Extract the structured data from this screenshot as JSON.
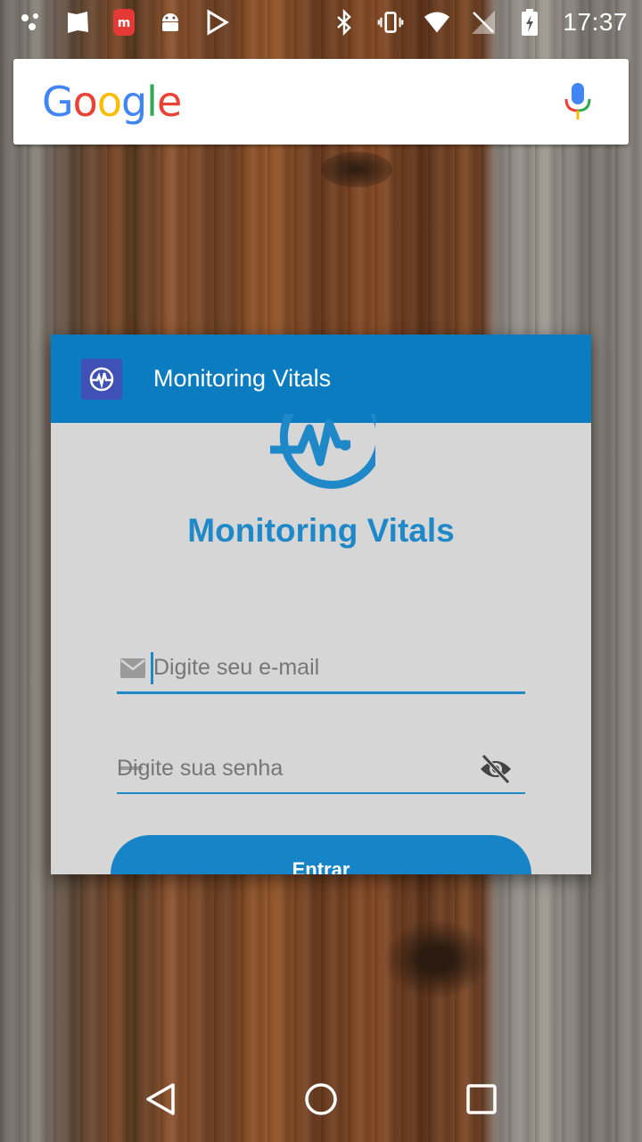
{
  "status_bar": {
    "time": "17:37",
    "left_icons": [
      "notification-dots-icon",
      "map-icon",
      "app-m-icon",
      "android-icon",
      "play-store-icon"
    ],
    "right_icons": [
      "bluetooth-icon",
      "vibrate-icon",
      "wifi-icon",
      "no-sim-icon",
      "battery-charging-icon"
    ]
  },
  "google_search": {
    "logo": [
      "G",
      "o",
      "o",
      "g",
      "l",
      "e"
    ],
    "mic_icon": "mic-icon"
  },
  "app_window": {
    "title": "Monitoring Vitals",
    "icon": "vitals-icon",
    "accent_color": "#0c7cc1"
  },
  "login": {
    "heading": "Monitoring Vitals",
    "email_placeholder": "Digite seu e-mail",
    "password_placeholder": "Digite sua senha",
    "submit_label": "Entrar",
    "colors": {
      "primary": "#1f88c9",
      "background": "#d6d6d6"
    }
  },
  "nav_bar": {
    "icons": [
      "back-icon",
      "home-icon",
      "recents-icon"
    ]
  }
}
